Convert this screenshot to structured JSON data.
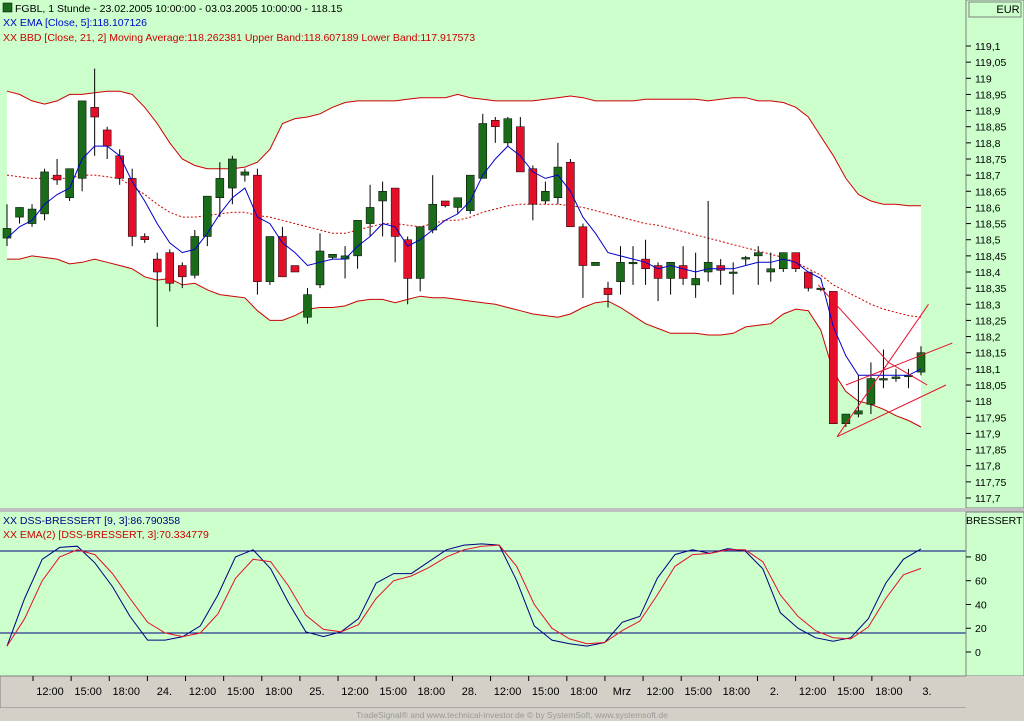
{
  "main_chart": {
    "header": [
      {
        "text": "FGBL, 1 Stunde - 23.02.2005 10:00:00 - 03.03.2005 10:00:00 - 118.15",
        "color": "#000000",
        "marker": "green-box"
      },
      {
        "text": "XX EMA [Close, 5]:118.107126",
        "color": "#0000cc"
      },
      {
        "text": "XX BBD [Close, 21, 2] Moving Average:118.262381 Upper Band:118.607189 Lower Band:117.917573",
        "color": "#cc0000"
      }
    ],
    "currency": "EUR",
    "price_ticks": [
      "119,1",
      "119,05",
      "119",
      "118,95",
      "118,9",
      "118,85",
      "118,8",
      "118,75",
      "118,7",
      "118,65",
      "118,6",
      "118,55",
      "118,5",
      "118,45",
      "118,4",
      "118,35",
      "118,3",
      "118,25",
      "118,2",
      "118,15",
      "118,1",
      "118,05",
      "118",
      "117,95",
      "117,9",
      "117,85",
      "117,8",
      "117,75",
      "117,7"
    ]
  },
  "osc_chart": {
    "header": [
      {
        "text": "XX DSS-BRESSERT [9, 3]:86.790358",
        "color": "#000080"
      },
      {
        "text": "XX EMA(2) [DSS-BRESSERT, 3]:70.334779",
        "color": "#cc0000"
      }
    ],
    "axis_title": "BRESSERT",
    "ticks": [
      "80",
      "60",
      "40",
      "20",
      "0"
    ],
    "levels": [
      85,
      16
    ]
  },
  "time_axis": [
    "12:00",
    "15:00",
    "18:00",
    "24.",
    "12:00",
    "15:00",
    "18:00",
    "25.",
    "12:00",
    "15:00",
    "18:00",
    "28.",
    "12:00",
    "15:00",
    "18:00",
    "Mrz",
    "12:00",
    "15:00",
    "18:00",
    "2.",
    "12:00",
    "15:00",
    "18:00",
    "3."
  ],
  "footer": "TradeSignal® and www.technical-investor.de © by SystemSoft, www.systemsoft.de",
  "colors": {
    "up": "#1a6b1a",
    "down": "#e4102a",
    "bg": "#ccffcc",
    "band_fill": "#ffffff",
    "band": "#cc0000",
    "ema": "#0000cc",
    "dss": "#000080",
    "dss_ema": "#e4102a"
  },
  "chart_data": [
    {
      "type": "candlestick",
      "title": "FGBL, 1 Stunde - 23.02.2005 10:00:00 - 03.03.2005 10:00:00 - 118.15",
      "ylim": [
        117.68,
        119.16
      ],
      "candles": [
        [
          118.505,
          118.61,
          118.48,
          118.535
        ],
        [
          118.57,
          118.6,
          118.55,
          118.6
        ],
        [
          118.55,
          118.61,
          118.54,
          118.595
        ],
        [
          118.58,
          118.72,
          118.56,
          118.71
        ],
        [
          118.7,
          118.75,
          118.67,
          118.685
        ],
        [
          118.63,
          118.72,
          118.62,
          118.72
        ],
        [
          118.69,
          118.93,
          118.65,
          118.93
        ],
        [
          118.91,
          119.03,
          118.76,
          118.88
        ],
        [
          118.84,
          118.85,
          118.75,
          118.79
        ],
        [
          118.76,
          118.78,
          118.67,
          118.69
        ],
        [
          118.69,
          118.72,
          118.48,
          118.51
        ],
        [
          118.51,
          118.52,
          118.49,
          118.5
        ],
        [
          118.44,
          118.46,
          118.23,
          118.4
        ],
        [
          118.46,
          118.47,
          118.34,
          118.365
        ],
        [
          118.42,
          118.43,
          118.35,
          118.385
        ],
        [
          118.39,
          118.53,
          118.38,
          118.51
        ],
        [
          118.51,
          118.63,
          118.48,
          118.635
        ],
        [
          118.63,
          118.74,
          118.57,
          118.69
        ],
        [
          118.66,
          118.76,
          118.61,
          118.75
        ],
        [
          118.7,
          118.72,
          118.68,
          118.71
        ],
        [
          118.7,
          118.72,
          118.33,
          118.37
        ],
        [
          118.37,
          118.51,
          118.36,
          118.51
        ],
        [
          118.51,
          118.54,
          118.4,
          118.385
        ],
        [
          118.42,
          118.42,
          118.41,
          118.4
        ],
        [
          118.26,
          118.35,
          118.24,
          118.33
        ],
        [
          118.36,
          118.52,
          118.35,
          118.465
        ],
        [
          118.445,
          118.45,
          118.44,
          118.455
        ],
        [
          118.44,
          118.48,
          118.38,
          118.45
        ],
        [
          118.45,
          118.55,
          118.41,
          118.56
        ],
        [
          118.55,
          118.67,
          118.51,
          118.6
        ],
        [
          118.62,
          118.68,
          118.51,
          118.65
        ],
        [
          118.66,
          118.66,
          118.43,
          118.51
        ],
        [
          118.5,
          118.51,
          118.3,
          118.38
        ],
        [
          118.38,
          118.51,
          118.34,
          118.54
        ],
        [
          118.53,
          118.7,
          118.52,
          118.61
        ],
        [
          118.62,
          118.62,
          118.6,
          118.605
        ],
        [
          118.6,
          118.62,
          118.58,
          118.63
        ],
        [
          118.59,
          118.69,
          118.58,
          118.7
        ],
        [
          118.69,
          118.89,
          118.69,
          118.86
        ],
        [
          118.87,
          118.88,
          118.8,
          118.85
        ],
        [
          118.8,
          118.88,
          118.79,
          118.875
        ],
        [
          118.85,
          118.88,
          118.71,
          118.71
        ],
        [
          118.72,
          118.73,
          118.56,
          118.61
        ],
        [
          118.62,
          118.68,
          118.61,
          118.65
        ],
        [
          118.63,
          118.8,
          118.61,
          118.725
        ],
        [
          118.74,
          118.75,
          118.59,
          118.54
        ],
        [
          118.54,
          118.55,
          118.32,
          118.42
        ],
        [
          118.42,
          118.42,
          118.42,
          118.43
        ],
        [
          118.35,
          118.37,
          118.29,
          118.33
        ],
        [
          118.37,
          118.48,
          118.33,
          118.43
        ],
        [
          118.43,
          118.48,
          118.36,
          118.43
        ],
        [
          118.44,
          118.5,
          118.36,
          118.41
        ],
        [
          118.42,
          118.43,
          118.31,
          118.38
        ],
        [
          118.38,
          118.43,
          118.33,
          118.43
        ],
        [
          118.42,
          118.48,
          118.36,
          118.38
        ],
        [
          118.36,
          118.46,
          118.32,
          118.38
        ],
        [
          118.4,
          118.62,
          118.37,
          118.43
        ],
        [
          118.42,
          118.44,
          118.36,
          118.405
        ],
        [
          118.4,
          118.43,
          118.33,
          118.4
        ],
        [
          118.44,
          118.45,
          118.42,
          118.445
        ],
        [
          118.45,
          118.48,
          118.36,
          118.46
        ],
        [
          118.4,
          118.46,
          118.37,
          118.41
        ],
        [
          118.41,
          118.46,
          118.4,
          118.46
        ],
        [
          118.46,
          118.46,
          118.4,
          118.41
        ],
        [
          118.4,
          118.4,
          118.34,
          118.35
        ],
        [
          118.35,
          118.35,
          118.34,
          118.35
        ],
        [
          118.34,
          118.34,
          117.93,
          117.93
        ],
        [
          117.93,
          117.95,
          117.92,
          117.96
        ],
        [
          117.96,
          118.08,
          117.95,
          117.97
        ],
        [
          117.99,
          118.12,
          117.96,
          118.07
        ],
        [
          118.07,
          118.16,
          118.04,
          118.07
        ],
        [
          118.07,
          118.1,
          118.06,
          118.075
        ],
        [
          118.08,
          118.1,
          118.04,
          118.08
        ],
        [
          118.09,
          118.17,
          118.08,
          118.15
        ]
      ],
      "ema5": [
        118.505,
        118.54,
        118.56,
        118.61,
        118.64,
        118.66,
        118.75,
        118.79,
        118.79,
        118.76,
        118.68,
        118.62,
        118.55,
        118.49,
        118.46,
        118.47,
        118.52,
        118.58,
        118.63,
        118.66,
        118.57,
        118.55,
        118.49,
        118.46,
        118.42,
        118.43,
        118.44,
        118.44,
        118.48,
        118.51,
        118.55,
        118.54,
        118.48,
        118.5,
        118.53,
        118.56,
        118.58,
        118.62,
        118.7,
        118.75,
        118.79,
        118.76,
        118.71,
        118.69,
        118.7,
        118.65,
        118.57,
        118.52,
        118.46,
        118.45,
        118.44,
        118.43,
        118.41,
        118.42,
        118.41,
        118.4,
        118.41,
        118.41,
        118.41,
        118.42,
        118.43,
        118.43,
        118.44,
        118.43,
        118.4,
        118.38,
        118.23,
        118.14,
        118.08,
        118.08,
        118.08,
        118.08,
        118.08,
        118.1
      ],
      "bollinger_ma": [
        118.7,
        118.695,
        118.69,
        118.69,
        118.69,
        118.69,
        118.7,
        118.7,
        118.695,
        118.69,
        118.665,
        118.64,
        118.61,
        118.585,
        118.57,
        118.57,
        118.575,
        118.58,
        118.585,
        118.585,
        118.575,
        118.57,
        118.56,
        118.55,
        118.54,
        118.53,
        118.52,
        118.52,
        118.53,
        118.54,
        118.55,
        118.55,
        118.545,
        118.54,
        118.55,
        118.56,
        118.56,
        118.57,
        118.585,
        118.595,
        118.605,
        118.61,
        118.61,
        118.61,
        118.61,
        118.605,
        118.6,
        118.59,
        118.58,
        118.57,
        118.56,
        118.55,
        118.545,
        118.535,
        118.525,
        118.515,
        118.505,
        118.495,
        118.485,
        118.475,
        118.465,
        118.455,
        118.445,
        118.43,
        118.41,
        118.39,
        118.36,
        118.34,
        118.32,
        118.3,
        118.285,
        118.275,
        118.265,
        118.26
      ],
      "bollinger_upper": [
        118.96,
        118.95,
        118.93,
        118.92,
        118.93,
        118.95,
        118.95,
        118.955,
        118.96,
        118.96,
        118.95,
        118.91,
        118.86,
        118.8,
        118.75,
        118.73,
        118.72,
        118.72,
        118.72,
        118.725,
        118.74,
        118.78,
        118.86,
        118.875,
        118.88,
        118.89,
        118.91,
        118.925,
        118.93,
        118.93,
        118.93,
        118.93,
        118.935,
        118.94,
        118.94,
        118.94,
        118.95,
        118.94,
        118.935,
        118.93,
        118.93,
        118.93,
        118.93,
        118.935,
        118.94,
        118.945,
        118.94,
        118.93,
        118.93,
        118.93,
        118.93,
        118.935,
        118.935,
        118.935,
        118.935,
        118.935,
        118.93,
        118.935,
        118.94,
        118.94,
        118.93,
        118.93,
        118.925,
        118.91,
        118.88,
        118.82,
        118.76,
        118.69,
        118.64,
        118.62,
        118.61,
        118.61,
        118.605,
        118.605
      ],
      "bollinger_lower": [
        118.44,
        118.44,
        118.45,
        118.445,
        118.44,
        118.425,
        118.43,
        118.44,
        118.43,
        118.42,
        118.41,
        118.385,
        118.375,
        118.38,
        118.36,
        118.365,
        118.345,
        118.33,
        118.325,
        118.32,
        118.28,
        118.25,
        118.25,
        118.265,
        118.285,
        118.29,
        118.29,
        118.295,
        118.31,
        118.315,
        118.315,
        118.305,
        118.315,
        118.325,
        118.32,
        118.32,
        118.315,
        118.31,
        118.305,
        118.3,
        118.29,
        118.28,
        118.27,
        118.265,
        118.26,
        118.27,
        118.29,
        118.305,
        118.31,
        118.29,
        118.265,
        118.24,
        118.225,
        118.21,
        118.21,
        118.21,
        118.205,
        118.205,
        118.21,
        118.23,
        118.235,
        118.24,
        118.27,
        118.285,
        118.28,
        118.22,
        118.09,
        118.03,
        118.0,
        117.99,
        117.975,
        117.955,
        117.94,
        117.92
      ]
    },
    {
      "type": "line",
      "title": "DSS-BRESSERT [9, 3]",
      "ylim": [
        -8,
        95
      ],
      "series": [
        {
          "name": "DSS-BRESSERT [9, 3]",
          "values": [
            5,
            45,
            78,
            88,
            89,
            75,
            55,
            30,
            10,
            10,
            13,
            22,
            48,
            80,
            86,
            70,
            42,
            17,
            13,
            17,
            28,
            58,
            66,
            66,
            76,
            86,
            90,
            91,
            90,
            60,
            22,
            10,
            7,
            5,
            8,
            25,
            30,
            62,
            82,
            86,
            83,
            87,
            85,
            70,
            33,
            20,
            12,
            9,
            12,
            28,
            58,
            78,
            86.79
          ]
        },
        {
          "name": "EMA(2) [DSS-BRESSERT, 3]",
          "values": [
            5,
            28,
            60,
            80,
            86,
            82,
            66,
            45,
            25,
            16,
            13,
            16,
            32,
            62,
            78,
            76,
            56,
            31,
            19,
            17,
            23,
            45,
            60,
            64,
            71,
            80,
            86,
            89,
            90,
            72,
            40,
            20,
            11,
            7,
            8,
            18,
            26,
            48,
            72,
            82,
            83,
            86,
            86,
            76,
            48,
            30,
            18,
            12,
            11,
            21,
            45,
            65,
            70.33
          ]
        }
      ],
      "levels": [
        85,
        16
      ]
    }
  ]
}
